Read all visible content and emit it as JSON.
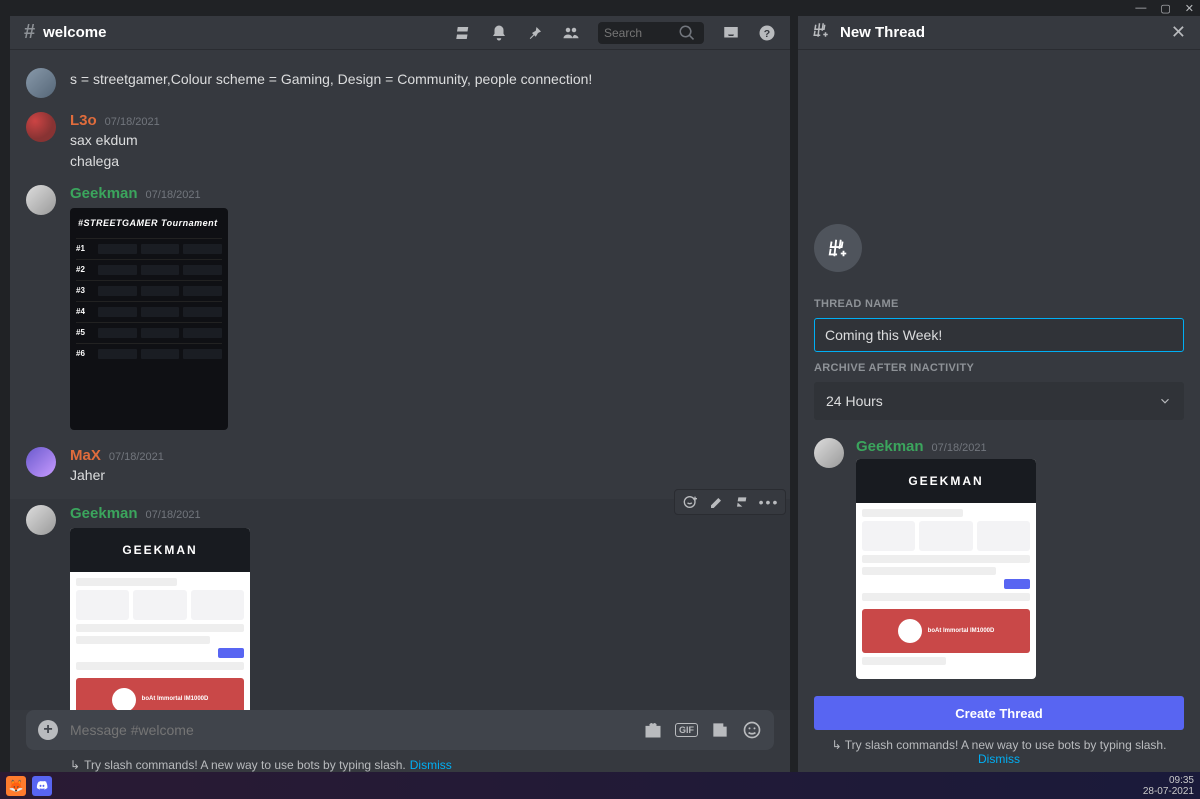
{
  "window": {
    "minimize": "—",
    "maximize": "▢",
    "close": "✕"
  },
  "channel": {
    "name": "welcome"
  },
  "search": {
    "placeholder": "Search"
  },
  "messages": {
    "m0": {
      "text": "s = streetgamer,Colour scheme = Gaming, Design = Community, people  connection!"
    },
    "m1": {
      "author": "L3o",
      "time": "07/18/2021",
      "line1": "sax ekdum",
      "line2": "chalega"
    },
    "m2": {
      "author": "Geekman",
      "time": "07/18/2021",
      "att_title": "#STREETGAMER Tournament",
      "rows": [
        "#1",
        "#2",
        "#3",
        "#4",
        "#5",
        "#6"
      ]
    },
    "m3": {
      "author": "MaX",
      "time": "07/18/2021",
      "text": "Jaher"
    },
    "m4": {
      "author": "Geekman",
      "time": "07/18/2021",
      "att_logo": "GEEKMAN",
      "banner_label": "boAt Immortal IM1000D"
    }
  },
  "composer": {
    "placeholder": "Message #welcome",
    "tip": "Try slash commands! A new way to use bots by typing slash.",
    "dismiss": "Dismiss",
    "gif": "GIF"
  },
  "thread": {
    "header": "New Thread",
    "name_label": "THREAD NAME",
    "name_value": "Coming this Week!",
    "archive_label": "ARCHIVE AFTER INACTIVITY",
    "archive_value": "24 Hours",
    "preview": {
      "author": "Geekman",
      "time": "07/18/2021",
      "att_logo": "GEEKMAN",
      "banner_label": "boAt Immortal IM1000D"
    },
    "create": "Create Thread",
    "tip": "Try slash commands! A new way to use bots by typing slash.",
    "dismiss": "Dismiss"
  },
  "taskbar": {
    "time": "09:35",
    "date": "28-07-2021"
  }
}
